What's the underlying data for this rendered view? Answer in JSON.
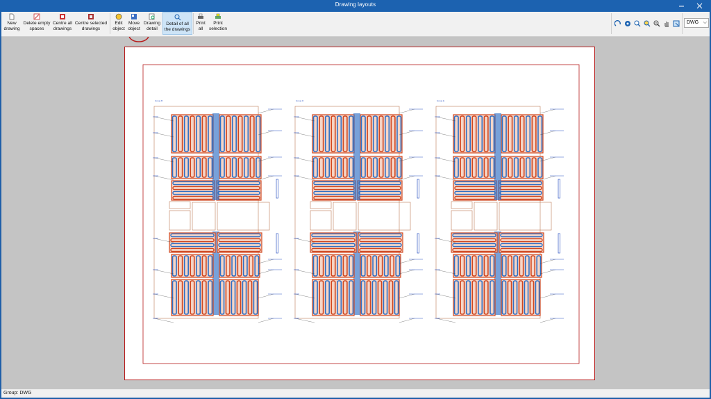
{
  "window": {
    "title": "Drawing layouts"
  },
  "toolbar": {
    "buttons": [
      {
        "id": "new-drawing",
        "line1": "New",
        "line2": "drawing",
        "icon": "new-document-icon"
      },
      {
        "id": "delete-empty-spaces",
        "line1": "Delete empty",
        "line2": "spaces",
        "icon": "delete-spaces-icon"
      },
      {
        "id": "centre-all-drawings",
        "line1": "Centre all",
        "line2": "drawings",
        "icon": "centre-all-icon"
      },
      {
        "id": "centre-selected-drawings",
        "line1": "Centre selected",
        "line2": "drawings",
        "icon": "centre-selected-icon"
      },
      {
        "id": "edit-object",
        "line1": "Edit",
        "line2": "object",
        "icon": "edit-icon"
      },
      {
        "id": "move-object",
        "line1": "Move",
        "line2": "object",
        "icon": "move-icon"
      },
      {
        "id": "drawing-detail",
        "line1": "Drawing",
        "line2": "detail",
        "icon": "detail-icon"
      },
      {
        "id": "detail-all-drawings",
        "line1": "Detail of all",
        "line2": "the drawings",
        "icon": "detail-all-icon"
      },
      {
        "id": "print-all",
        "line1": "Print",
        "line2": "all",
        "icon": "printer-icon"
      },
      {
        "id": "print-selection",
        "line1": "Print",
        "line2": "selection",
        "icon": "print-selection-icon"
      }
    ],
    "format_select": {
      "value": "DWG"
    }
  },
  "drawing": {
    "group_labels": [
      "Group B",
      "Group D",
      "Group E"
    ]
  },
  "status": {
    "text": "Group: DWG"
  },
  "colors": {
    "titlebar": "#1c62b0",
    "sheet_border": "#b71c1c",
    "red_circuit": "#d0461f",
    "blue_circuit": "#2f6fc4"
  }
}
